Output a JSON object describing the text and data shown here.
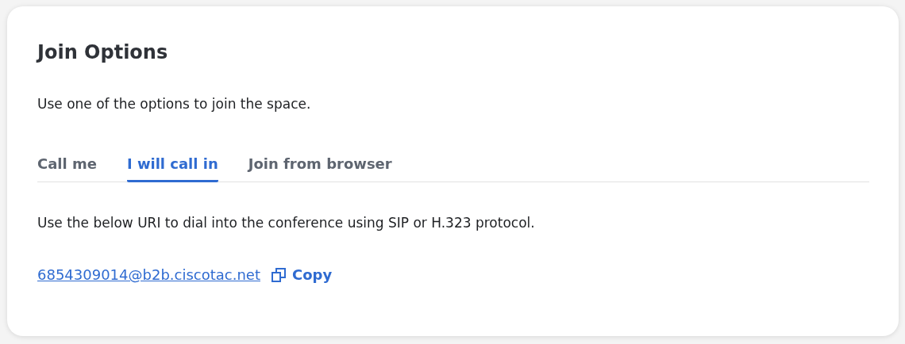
{
  "card": {
    "title": "Join Options",
    "intro": "Use one of the options to join the space.",
    "tabs": [
      {
        "label": "Call me",
        "selected": false
      },
      {
        "label": "I will call in",
        "selected": true
      },
      {
        "label": "Join from browser",
        "selected": false
      }
    ],
    "description": "Use the below URI to dial into the conference using SIP or H.323 protocol.",
    "uri": "6854309014@b2b.ciscotac.net",
    "copy_label": "Copy"
  }
}
